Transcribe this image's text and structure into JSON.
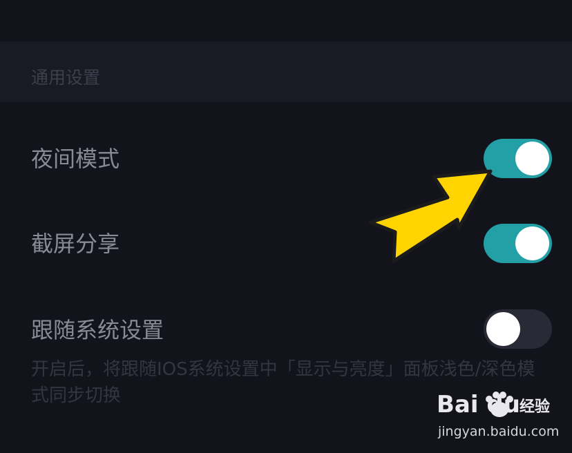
{
  "section": {
    "title": "通用设置"
  },
  "settings": [
    {
      "label": "夜间模式",
      "enabled": true
    },
    {
      "label": "截屏分享",
      "enabled": true
    },
    {
      "label": "跟随系统设置",
      "enabled": false
    }
  ],
  "description": "开启后，将跟随IOS系统设置中「显示与亮度」面板浅色/深色模式同步切换",
  "watermark": {
    "brand": "Bai du",
    "product": "经验",
    "url": "jingyan.baidu.com"
  },
  "colors": {
    "background": "#13131c",
    "section_header": "#1a1a24",
    "toggle_on": "#23a0a6",
    "toggle_off": "#2a2a36",
    "arrow": "#ffd400"
  },
  "icons": {
    "annotation": "yellow-arrow-icon",
    "watermark_logo": "baidu-paw-icon"
  }
}
